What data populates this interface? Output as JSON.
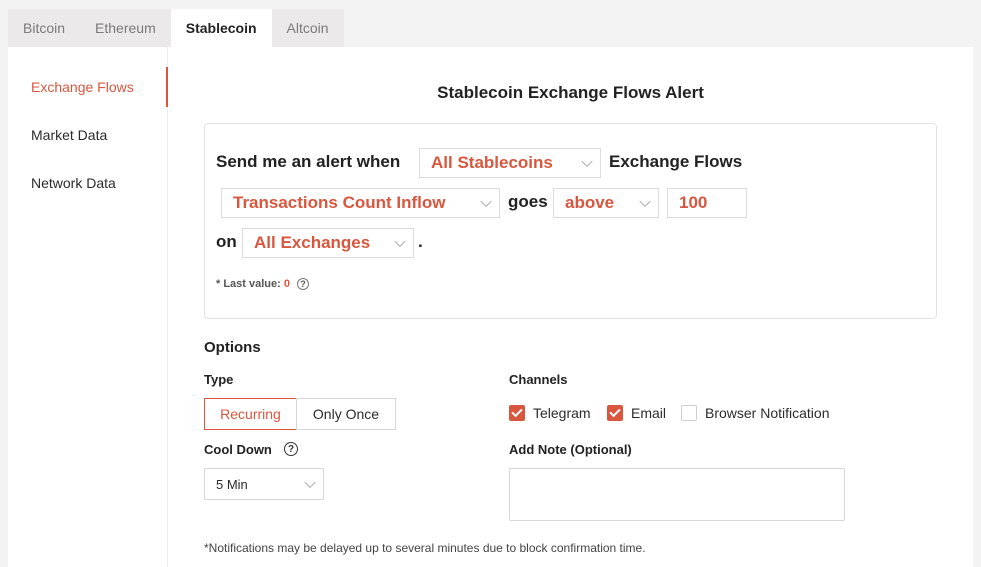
{
  "tabs": [
    "Bitcoin",
    "Ethereum",
    "Stablecoin",
    "Altcoin"
  ],
  "sidebar": {
    "items": [
      "Exchange Flows",
      "Market Data",
      "Network Data"
    ]
  },
  "title": "Stablecoin Exchange Flows Alert",
  "builder": {
    "send_text": "Send me an alert when",
    "asset": "All Stablecoins",
    "flows_text": "Exchange Flows",
    "metric": "Transactions Count Inflow",
    "goes_text": "goes",
    "direction": "above",
    "threshold": "100",
    "on_text": "on",
    "exchange": "All Exchanges",
    "period": ".",
    "last_value_label": "* Last value:",
    "last_value": "0",
    "help_glyph": "?"
  },
  "options": {
    "heading": "Options",
    "type_label": "Type",
    "type_recurring": "Recurring",
    "type_once": "Only Once",
    "cooldown_label": "Cool Down",
    "cooldown_value": "5 Min",
    "channels_label": "Channels",
    "channels": [
      {
        "label": "Telegram",
        "checked": true
      },
      {
        "label": "Email",
        "checked": true
      },
      {
        "label": "Browser Notification",
        "checked": false
      }
    ],
    "note_label": "Add Note (Optional)",
    "note_value": ""
  },
  "footnote": "*Notifications may be delayed up to several minutes due to block confirmation time.",
  "colors": {
    "accent": "#d9573e",
    "background": "#f4f3f3",
    "panel": "#ffffff"
  },
  "icons": {
    "dropdown": "chevron-down-icon",
    "help": "question-circle-icon",
    "check": "checkmark-icon"
  }
}
